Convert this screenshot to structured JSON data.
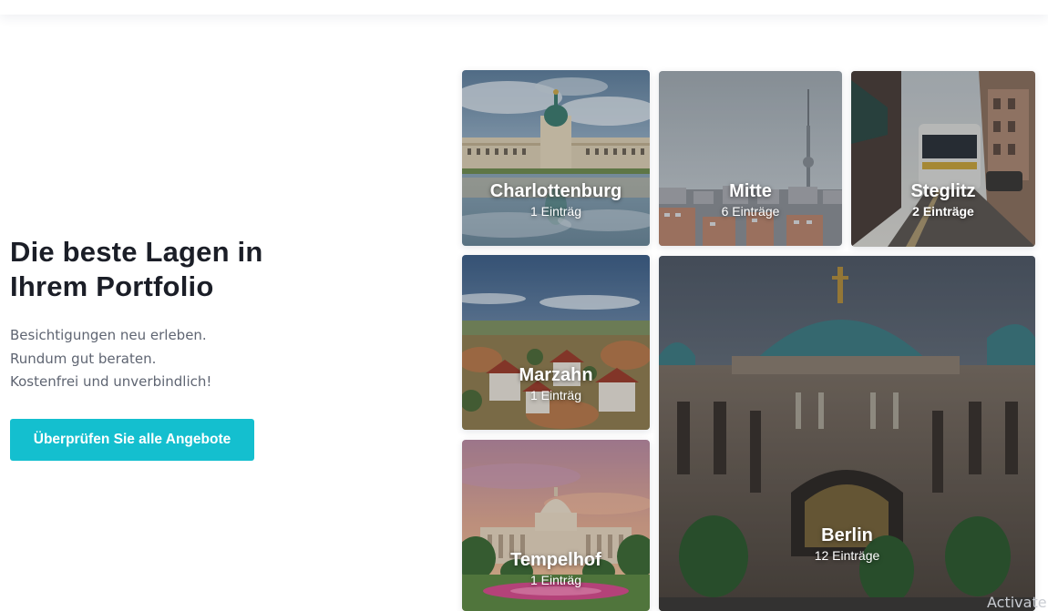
{
  "hero": {
    "title": "Die beste Lagen in Ihrem Portfolio",
    "subtitle_lines": [
      "Besichtigungen neu erleben.",
      "Rundum gut beraten.",
      "Kostenfrei und unverbindlich!"
    ],
    "cta_label": "Überprüfen Sie alle Angebote"
  },
  "locations": [
    {
      "name": "Charlottenburg",
      "count": "1 Einträg"
    },
    {
      "name": "Mitte",
      "count": "6 Einträge"
    },
    {
      "name": "Steglitz",
      "count": "2 Einträge"
    },
    {
      "name": "Marzahn",
      "count": "1 Einträg"
    },
    {
      "name": "Berlin",
      "count": "12 Einträge"
    },
    {
      "name": "Tempelhof",
      "count": "1 Einträg"
    }
  ],
  "watermark": "Activate",
  "colors": {
    "accent": "#14bfcf",
    "heading": "#1b1e27",
    "body_text": "#5f6572"
  }
}
